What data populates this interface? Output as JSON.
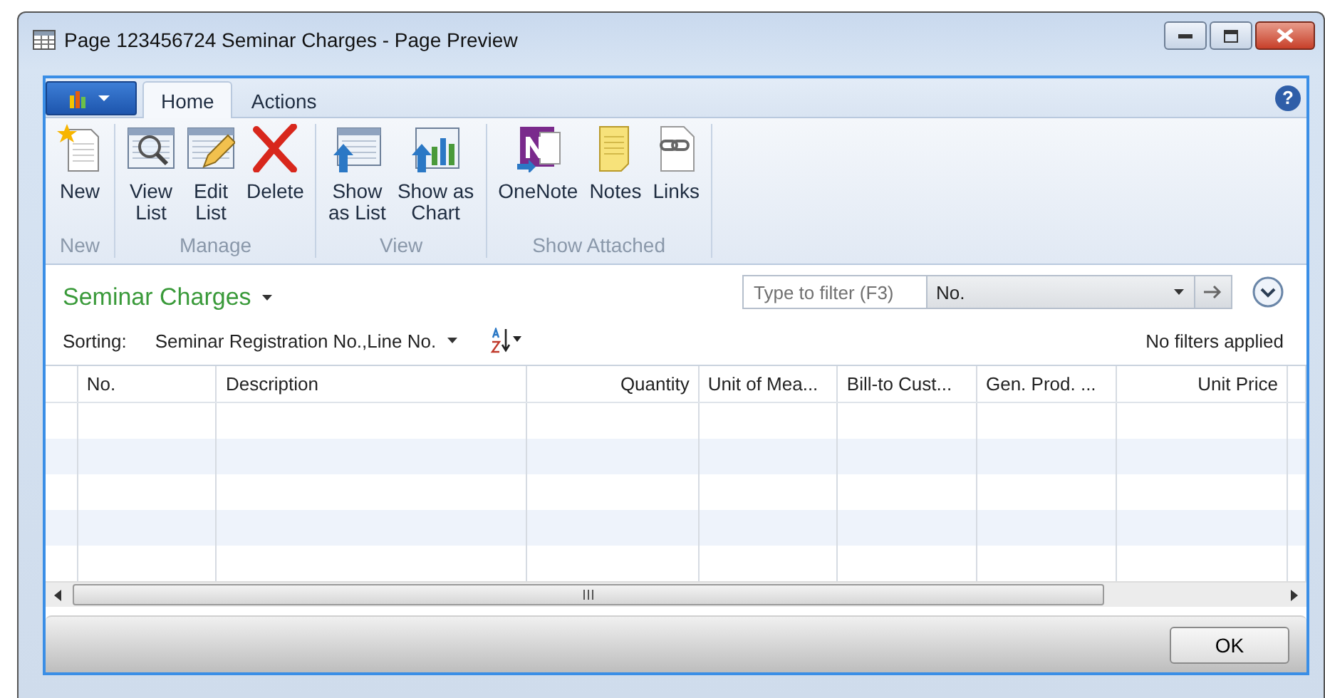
{
  "window": {
    "title": "Page 123456724 Seminar Charges - Page Preview"
  },
  "ribbon": {
    "tabs": [
      {
        "label": "Home",
        "selected": true
      },
      {
        "label": "Actions",
        "selected": false
      }
    ],
    "groups": [
      {
        "label": "New",
        "buttons": [
          {
            "lines": [
              "New"
            ]
          }
        ]
      },
      {
        "label": "Manage",
        "buttons": [
          {
            "lines": [
              "View",
              "List"
            ]
          },
          {
            "lines": [
              "Edit",
              "List"
            ]
          },
          {
            "lines": [
              "Delete"
            ]
          }
        ]
      },
      {
        "label": "View",
        "buttons": [
          {
            "lines": [
              "Show",
              "as List"
            ]
          },
          {
            "lines": [
              "Show as",
              "Chart"
            ]
          }
        ]
      },
      {
        "label": "Show Attached",
        "buttons": [
          {
            "lines": [
              "OneNote"
            ]
          },
          {
            "lines": [
              "Notes"
            ]
          },
          {
            "lines": [
              "Links"
            ]
          }
        ]
      }
    ]
  },
  "page": {
    "title": "Seminar Charges",
    "filter": {
      "placeholder": "Type to filter (F3)",
      "field": "No."
    },
    "sorting_label": "Sorting:",
    "sorting_value": "Seminar Registration No.,Line No.",
    "filter_status": "No filters applied"
  },
  "help_button": "?",
  "table": {
    "columns": [
      "No.",
      "Description",
      "Quantity",
      "Unit of Mea...",
      "Bill-to Cust...",
      "Gen. Prod. ...",
      "Unit Price"
    ]
  },
  "buttons": [
    "OK"
  ]
}
